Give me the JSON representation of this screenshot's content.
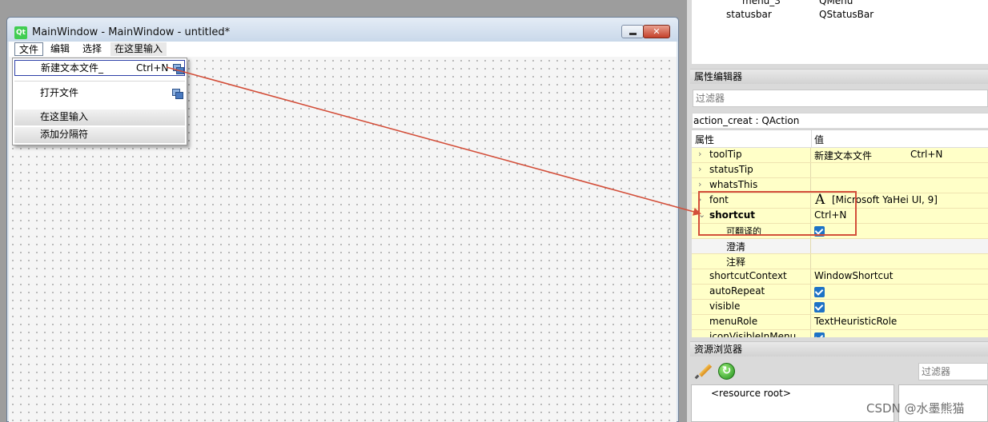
{
  "designer": {
    "window_title": "MainWindow - MainWindow - untitled*",
    "qt_logo": "Qt",
    "close_glyph": "✕",
    "menubar": {
      "file": "文件",
      "edit": "编辑",
      "select": "选择",
      "type_here": "在这里输入"
    },
    "dropdown": {
      "new_file": "新建文本文件_",
      "new_file_shortcut": "Ctrl+N",
      "open_file": "打开文件",
      "type_here": "在这里输入",
      "add_separator": "添加分隔符"
    }
  },
  "object_inspector": {
    "rows": [
      {
        "name": "menu_3",
        "class": "QMenu"
      },
      {
        "name": "statusbar",
        "class": "QStatusBar"
      }
    ]
  },
  "property_editor": {
    "title": "属性编辑器",
    "filter_placeholder": "过滤器",
    "object_label": "action_creat : QAction",
    "header_property": "属性",
    "header_value": "值",
    "rows": [
      {
        "name": "toolTip",
        "value": "新建文本文件",
        "extra": "Ctrl+N"
      },
      {
        "name": "statusTip",
        "value": ""
      },
      {
        "name": "whatsThis",
        "value": ""
      },
      {
        "name": "font",
        "value": "[Microsoft YaHei UI, 9]",
        "icon": "A"
      },
      {
        "name": "shortcut",
        "value": "Ctrl+N"
      },
      {
        "name": "可翻译的",
        "checked": true
      },
      {
        "name": "澄清",
        "value": ""
      },
      {
        "name": "注释",
        "value": ""
      },
      {
        "name": "shortcutContext",
        "value": "WindowShortcut"
      },
      {
        "name": "autoRepeat",
        "checked": true
      },
      {
        "name": "visible",
        "checked": true
      },
      {
        "name": "menuRole",
        "value": "TextHeuristicRole"
      },
      {
        "name": "iconVisibleInMenu",
        "checked": true
      }
    ]
  },
  "resource_browser": {
    "title": "资源浏览器",
    "filter_placeholder": "过滤器",
    "root": "<resource root>",
    "reload_glyph": "↻"
  },
  "watermark": "CSDN @水墨熊猫",
  "colors": {
    "highlight": "#d34f3a",
    "row_yellow": "#ffffc8",
    "checkbox": "#1d72c6"
  }
}
